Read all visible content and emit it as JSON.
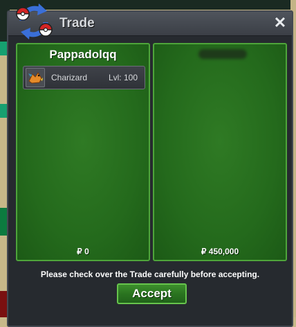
{
  "window": {
    "title": "Trade",
    "close_label": "✕",
    "notice": "Please check over the Trade carefully before accepting.",
    "accept_label": "Accept"
  },
  "left_panel": {
    "player_name": "Pappadolqq",
    "items": [
      {
        "name": "Charizard",
        "level": "Lvl: 100",
        "icon": "charizard-icon"
      }
    ],
    "money": "₽ 0"
  },
  "right_panel": {
    "player_name": "",
    "money": "₽ 450,000"
  },
  "colors": {
    "panel_green": "#2a7220",
    "panel_border": "#4ea53a",
    "window_bg": "#262a2f",
    "accept_border": "#67c44d"
  }
}
